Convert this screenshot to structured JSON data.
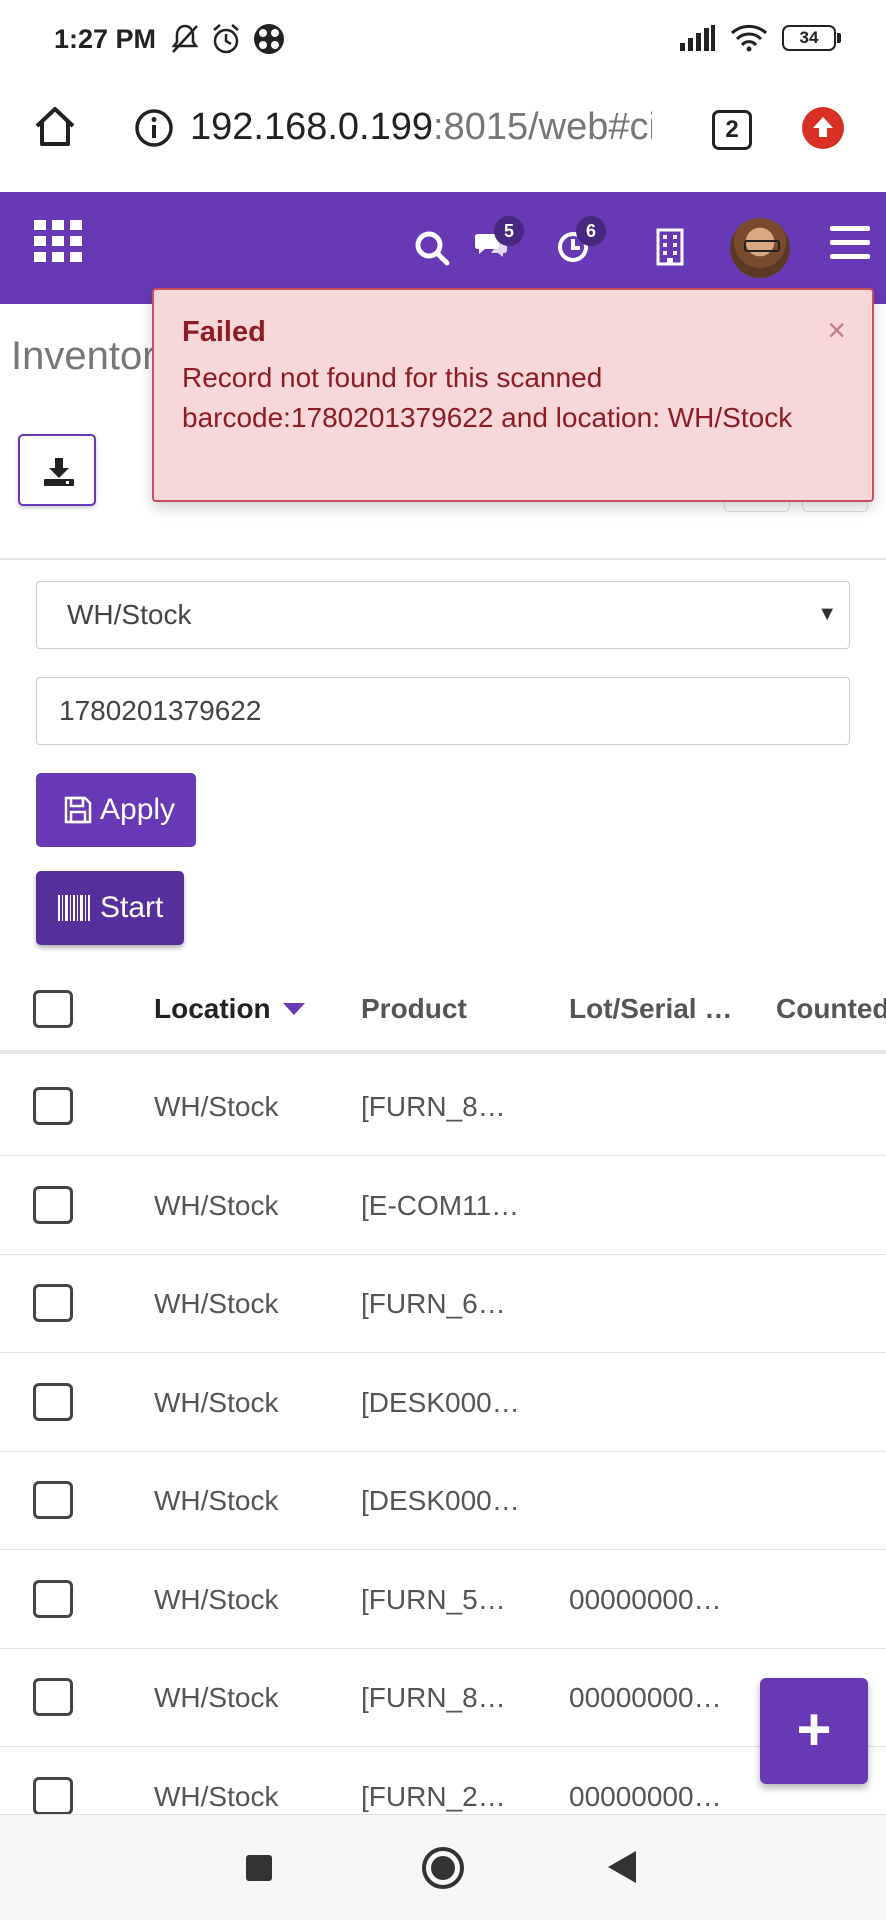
{
  "status_bar": {
    "time": "1:27 PM",
    "battery": "34"
  },
  "browser": {
    "url_host": "192.168.0.199",
    "url_rest": ":8015/web#cid",
    "tab_count": "2"
  },
  "navbar": {
    "messages_count": "5",
    "activities_count": "6"
  },
  "page": {
    "title": "Inventory"
  },
  "filters": {
    "location_selected": "WH/Stock",
    "barcode_value": "1780201379622"
  },
  "buttons": {
    "apply_label": "Apply",
    "start_label": "Start"
  },
  "table": {
    "headers": {
      "location": "Location",
      "product": "Product",
      "lot": "Lot/Serial …",
      "counted": "Counted"
    },
    "rows": [
      {
        "location": "WH/Stock",
        "product": "[FURN_8…",
        "lot": ""
      },
      {
        "location": "WH/Stock",
        "product": "[E-COM11…",
        "lot": ""
      },
      {
        "location": "WH/Stock",
        "product": "[FURN_6…",
        "lot": ""
      },
      {
        "location": "WH/Stock",
        "product": "[DESK000…",
        "lot": ""
      },
      {
        "location": "WH/Stock",
        "product": "[DESK000…",
        "lot": ""
      },
      {
        "location": "WH/Stock",
        "product": "[FURN_5…",
        "lot": "00000000…"
      },
      {
        "location": "WH/Stock",
        "product": "[FURN_8…",
        "lot": "00000000…"
      },
      {
        "location": "WH/Stock",
        "product": "[FURN_2…",
        "lot": "00000000…"
      }
    ]
  },
  "toast": {
    "title": "Failed",
    "message": "Record not found for this scanned barcode:1780201379622 and location: WH/Stock",
    "close": "×"
  },
  "fab": {
    "label": "+"
  },
  "colors": {
    "brand": "#6739b5",
    "toast_bg": "#f8d7da",
    "toast_text": "#8c1d24"
  }
}
